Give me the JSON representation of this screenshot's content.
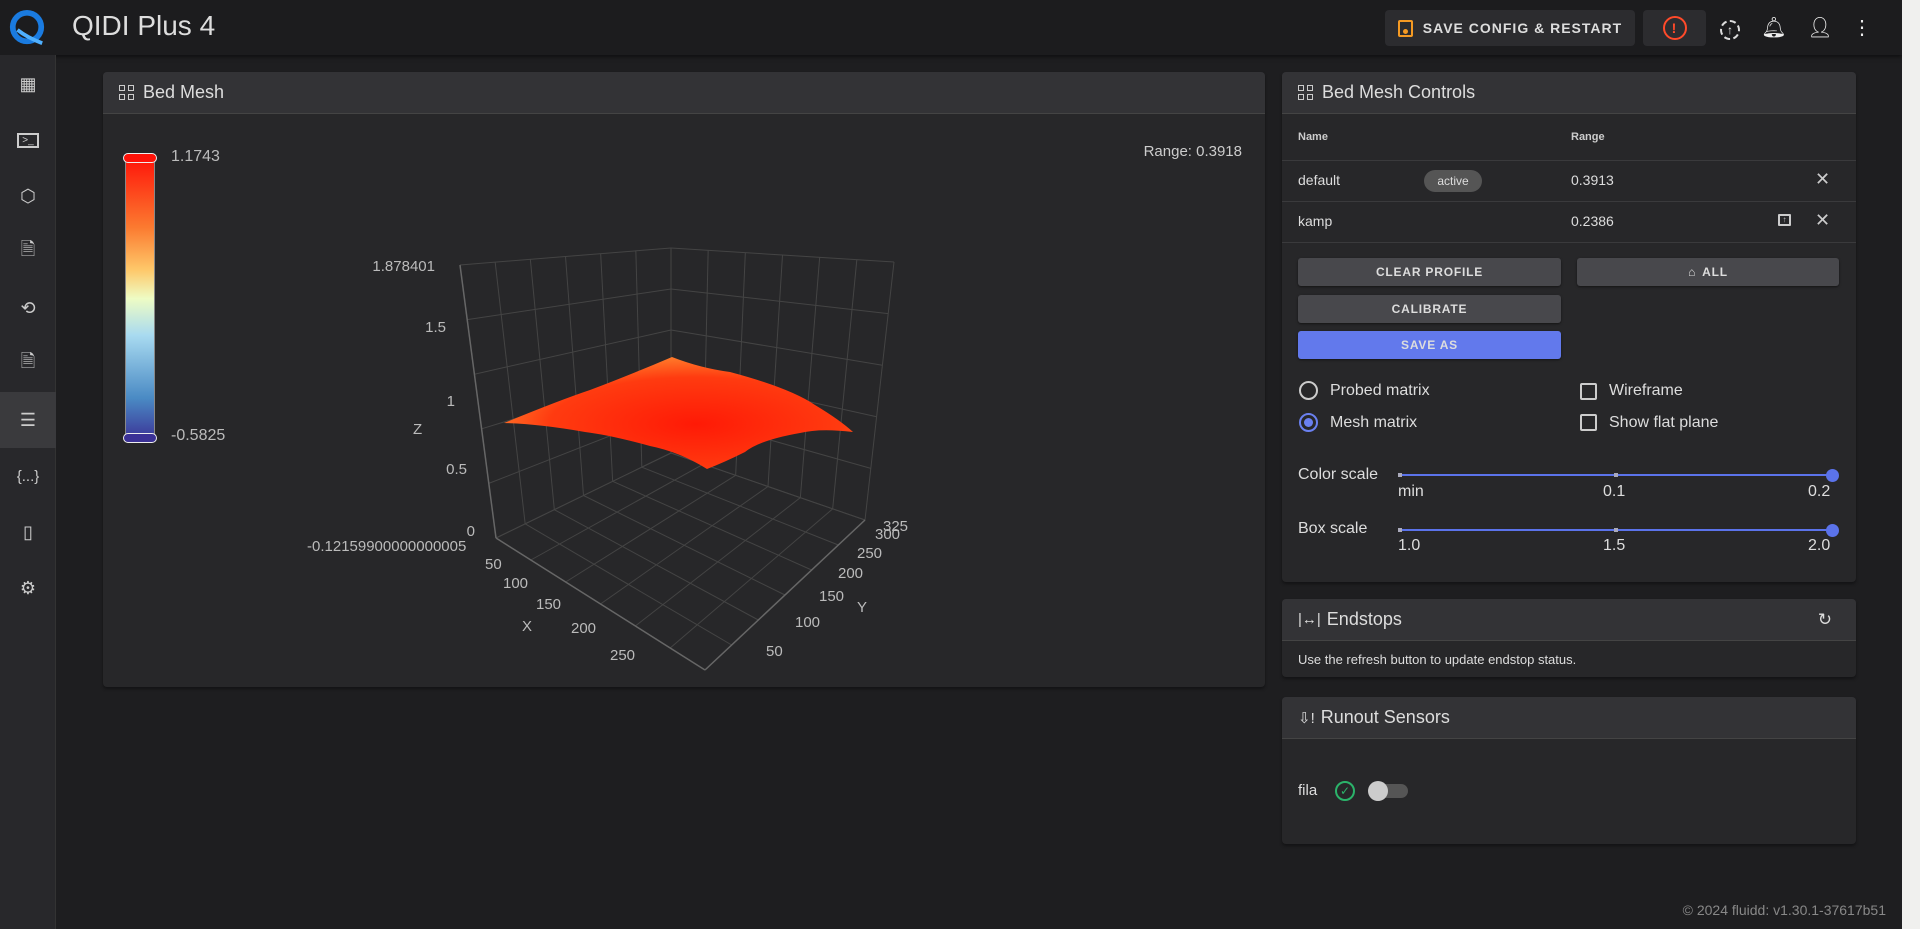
{
  "app": {
    "title": "QIDI Plus 4",
    "save_config_label": "SAVE CONFIG & RESTART",
    "footer": "© 2024 fluidd: v1.30.1-37617b51"
  },
  "header_icons": [
    "emergency-stop-icon",
    "upload-icon",
    "bell-icon",
    "account-icon",
    "more-vert-icon"
  ],
  "sidebar": {
    "items": [
      {
        "icon": "dashboard-icon"
      },
      {
        "icon": "console-icon"
      },
      {
        "icon": "cube-scan-icon"
      },
      {
        "icon": "file-table-icon"
      },
      {
        "icon": "history-icon"
      },
      {
        "icon": "file-video-icon"
      },
      {
        "icon": "tune-icon",
        "active": true
      },
      {
        "icon": "code-braces-icon"
      },
      {
        "icon": "printer-server-icon"
      },
      {
        "icon": "settings-icon"
      }
    ]
  },
  "bed_mesh": {
    "title": "Bed Mesh",
    "range_label": "Range: 0.3918",
    "colorbar": {
      "max": "1.1743",
      "min": "-0.5825"
    }
  },
  "chart_data": {
    "type": "surface",
    "xlabel": "X",
    "ylabel": "Y",
    "zlabel": "Z",
    "x_ticks": [
      "50",
      "100",
      "150",
      "200",
      "250"
    ],
    "y_ticks": [
      "50",
      "100",
      "150",
      "200",
      "250",
      "300",
      "325"
    ],
    "z_ticks": [
      "0",
      "0.5",
      "1",
      "1.5",
      "1.878401"
    ],
    "z_min_label": "-0.12159900000000005",
    "surface_color": "#ff2a0a",
    "colorscale": [
      "#3b3196",
      "#4a8ac4",
      "#a8daf0",
      "#eefcc4",
      "#fec86a",
      "#fb7a30",
      "#ff1208"
    ]
  },
  "controls": {
    "title": "Bed Mesh Controls",
    "columns": {
      "name": "Name",
      "range": "Range"
    },
    "profiles": [
      {
        "name": "default",
        "badge": "active",
        "range": "0.3913"
      },
      {
        "name": "kamp",
        "badge": "",
        "range": "0.2386"
      }
    ],
    "buttons": {
      "clear": "CLEAR PROFILE",
      "home": "ALL",
      "calibrate": "CALIBRATE",
      "save_as": "SAVE AS"
    },
    "radios": {
      "probed": "Probed matrix",
      "mesh": "Mesh matrix",
      "selected": "mesh"
    },
    "checks": {
      "wireframe": "Wireframe",
      "flat": "Show flat plane",
      "wireframe_checked": false,
      "flat_checked": false
    },
    "color_scale": {
      "label": "Color scale",
      "ticks": [
        "min",
        "0.1",
        "0.2"
      ],
      "value": "0.2"
    },
    "box_scale": {
      "label": "Box scale",
      "ticks": [
        "1.0",
        "1.5",
        "2.0"
      ],
      "value": "2.0"
    },
    "accent": "#5b73ea"
  },
  "endstops": {
    "title": "Endstops",
    "message": "Use the refresh button to update endstop status."
  },
  "runout": {
    "title": "Runout Sensors",
    "sensors": [
      {
        "name": "fila",
        "status": "ok",
        "enabled": false
      }
    ]
  }
}
